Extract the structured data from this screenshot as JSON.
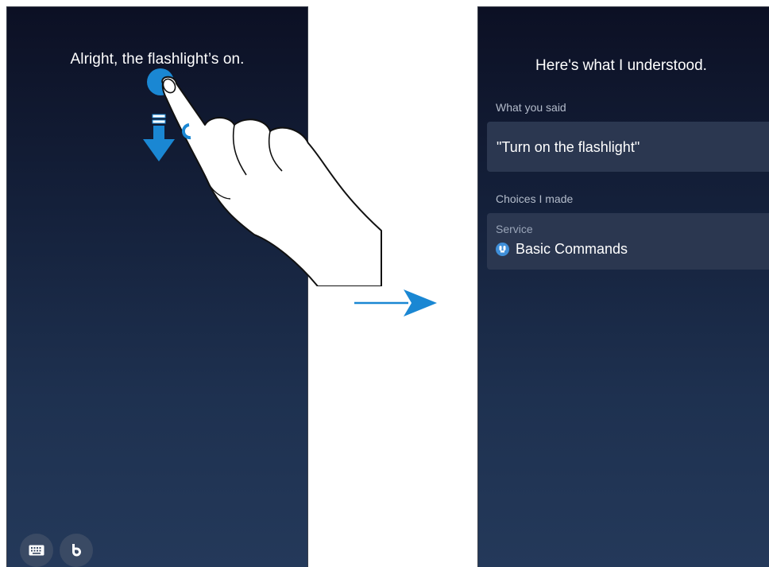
{
  "left_screen": {
    "response": "Alright, the flashlight’s on.",
    "bottom_buttons": [
      {
        "name": "keyboard-icon"
      },
      {
        "name": "bixby-icon"
      }
    ]
  },
  "right_screen": {
    "title": "Here's what I understood.",
    "what_you_said_label": "What you said",
    "what_you_said_value": "\"Turn on the flashlight\"",
    "choices_label": "Choices I made",
    "service_label": "Service",
    "service_value": "Basic Commands",
    "service_icon": "basic-commands-icon"
  },
  "colors": {
    "accent": "#1a87d3",
    "screen_top": "#0c1024",
    "screen_bottom": "#24395a",
    "card": "#2b3750"
  }
}
